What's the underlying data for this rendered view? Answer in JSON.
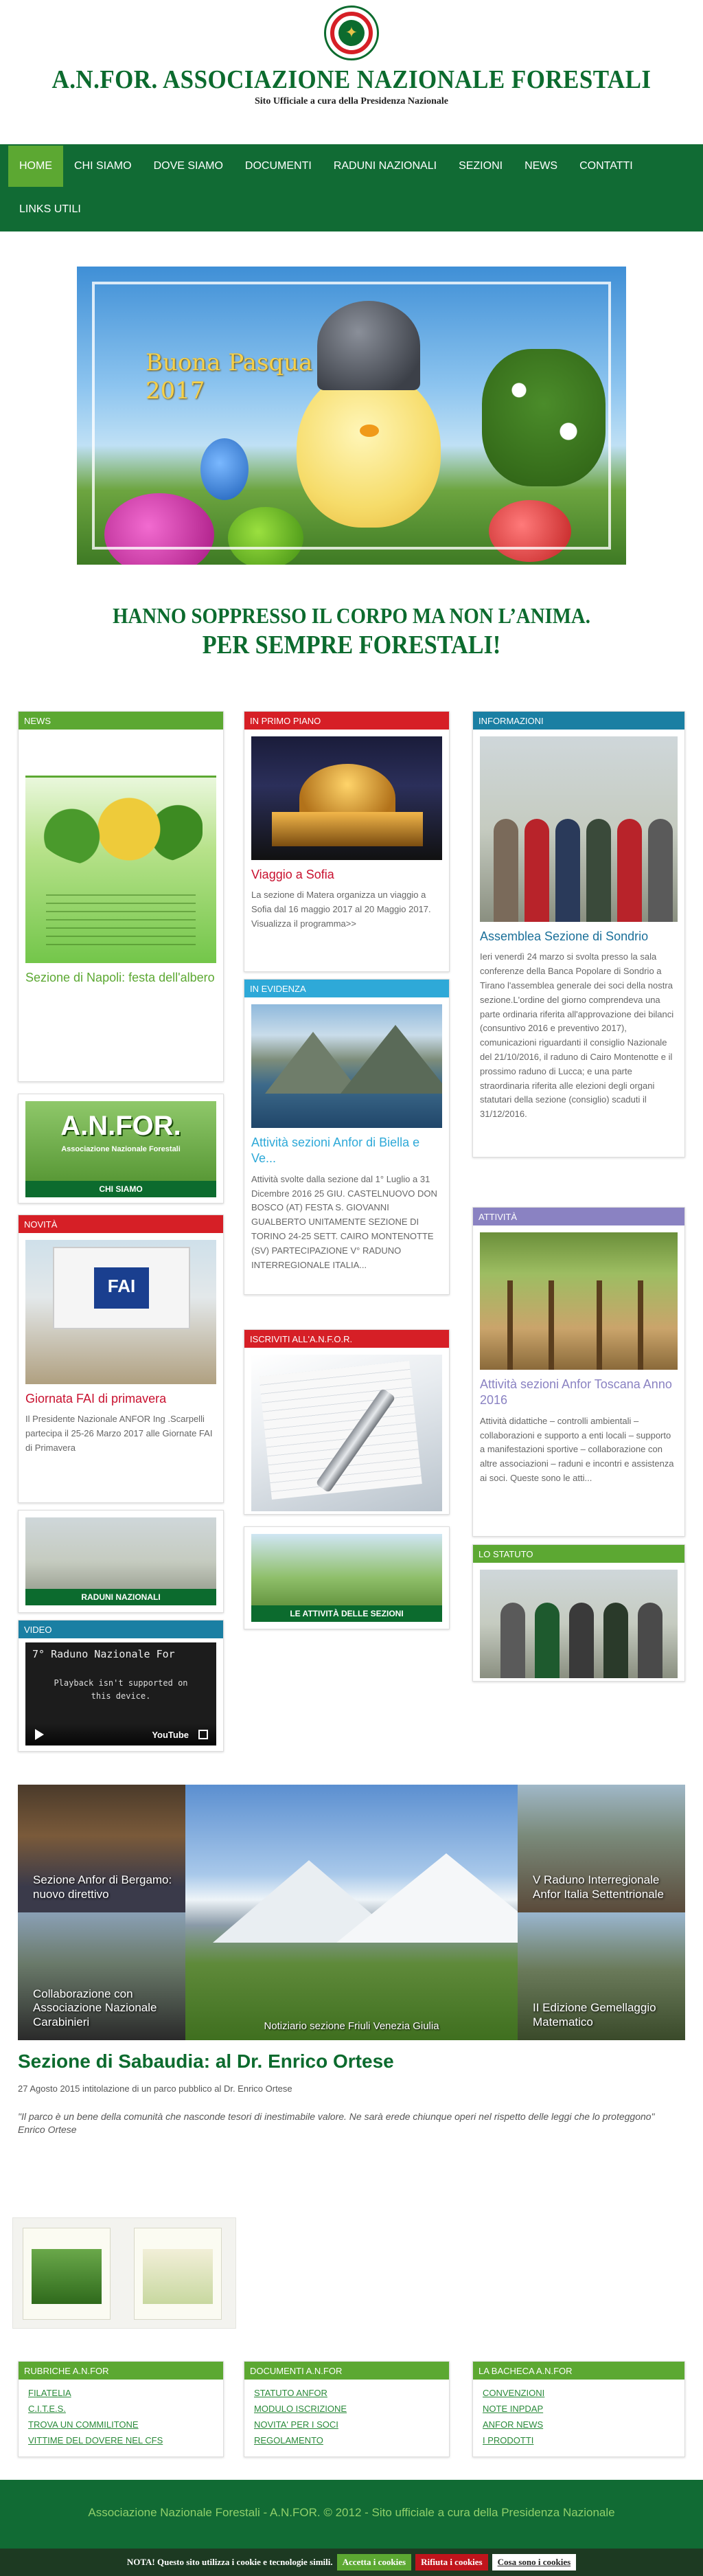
{
  "header": {
    "title": "A.N.FOR. ASSOCIAZIONE NAZIONALE FORESTALI",
    "tagline": "Sito Ufficiale a cura della Presidenza Nazionale"
  },
  "nav": {
    "items": [
      {
        "label": "HOME"
      },
      {
        "label": "CHI SIAMO"
      },
      {
        "label": "DOVE SIAMO"
      },
      {
        "label": "DOCUMENTI"
      },
      {
        "label": "RADUNI NAZIONALI"
      },
      {
        "label": "SEZIONI"
      },
      {
        "label": "NEWS"
      },
      {
        "label": "CONTATTI"
      },
      {
        "label": "LINKS UTILI"
      }
    ]
  },
  "hero": {
    "caption_line1": "Buona Pasqua",
    "caption_line2": "2017"
  },
  "slogan": {
    "line1": "HANNO SOPPRESSO IL CORPO MA NON L’ANIMA.",
    "line2": "PER SEMPRE FORESTALI!"
  },
  "col1": {
    "news": {
      "head": "NEWS",
      "title": "Sezione di Napoli: festa dell'albero"
    },
    "chi_siamo": {
      "logo_text": "A.N.FOR.",
      "logo_sub": "Associazione Nazionale Forestali",
      "caption": "CHI SIAMO"
    },
    "novita": {
      "head": "NOVITÀ",
      "sign": "FAI",
      "title": "Giornata FAI di primavera",
      "text": "Il Presidente Nazionale ANFOR Ing .Scarpelli partecipa il 25-26 Marzo 2017 alle  Giornate FAI di Primavera"
    },
    "raduni": {
      "caption": "RADUNI NAZIONALI"
    },
    "video": {
      "head": "VIDEO",
      "video_title": "7° Raduno Nazionale For",
      "msg_line1": "Playback isn't supported on",
      "msg_line2": "this device.",
      "yt": "YouTube"
    }
  },
  "col2": {
    "primo_piano": {
      "head": "IN PRIMO PIANO",
      "title": "Viaggio a Sofia",
      "text": "La sezione di Matera organizza un viaggio a Sofia dal 16 maggio 2017 al 20 Maggio 2017.  Visualizza il programma>>"
    },
    "evidenza": {
      "head": "IN EVIDENZA",
      "title": "Attività sezioni Anfor di Biella e Ve...",
      "text": "Attività svolte dalla sezione dal 1° Luglio a 31 Dicembre 2016 25 GIU. CASTELNUOVO DON BOSCO (AT) FESTA S. GIOVANNI GUALBERTO UNITAMENTE SEZIONE DI TORINO 24-25 SETT. CAIRO MONTENOTTE (SV) PARTECIPAZIONE V° RADUNO INTERREGIONALE ITALIA..."
    },
    "iscriviti": {
      "head": "ISCRIVITI ALL'A.N.F.O.R."
    },
    "attivita": {
      "caption": "LE ATTIVITÀ DELLE SEZIONI"
    }
  },
  "col3": {
    "informazioni": {
      "head": "INFORMAZIONI",
      "title": "Assemblea Sezione di Sondrio",
      "text": "Ieri venerdì 24 marzo si svolta presso la sala conferenze della Banca Popolare di Sondrio a Tirano l'assemblea generale dei soci della nostra sezione.L'ordine del giorno comprendeva una parte ordinaria riferita all'approvazione dei bilanci (consuntivo 2016 e preventivo 2017), comunicazioni riguardanti il consiglio Nazionale del 21/10/2016, il raduno di Cairo Montenotte e il prossimo raduno di Lucca; e una parte straordinaria riferita alle elezioni degli organi statutari della sezione (consiglio) scaduti il 31/12/2016."
    },
    "attivita": {
      "head": "ATTIVITÀ",
      "title": "Attività sezioni Anfor Toscana Anno 2016",
      "text": "Attività didattiche – controlli ambientali – collaborazioni e supporto a enti locali – supporto a manifestazioni sportive – collaborazione con altre associazioni – raduni e incontri e assistenza ai soci. Queste sono le atti..."
    },
    "statuto": {
      "head": "LO STATUTO"
    }
  },
  "gallery": {
    "center_caption": "Notiziario sezione Friuli Venezia Giulia",
    "thumbs": [
      {
        "caption": "Sezione Anfor di Bergamo: nuovo direttivo"
      },
      {
        "caption": "Collaborazione con Associazione Nazionale Carabinieri"
      },
      {
        "caption": "V Raduno Interregionale Anfor Italia Settentrionale"
      },
      {
        "caption": "II Edizione Gemellaggio Matematico"
      }
    ]
  },
  "article": {
    "title": "Sezione di Sabaudia: al Dr. Enrico Ortese",
    "meta": "27 Agosto 2015 intitolazione di un parco pubblico al Dr. Enrico Ortese",
    "quote": "\"Il parco è un bene della comunità che nasconde tesori di inestimabile valore. Ne sarà erede chiunque operi nel rispetto delle leggi che lo proteggono\"",
    "author": "Enrico Ortese"
  },
  "footer_widgets": [
    {
      "head": "RUBRICHE A.N.FOR",
      "links": [
        "FILATELIA",
        "C.I.T.E.S.",
        "TROVA UN COMMILITONE",
        "VITTIME DEL DOVERE NEL CFS"
      ]
    },
    {
      "head": "DOCUMENTI A.N.FOR",
      "links": [
        "STATUTO ANFOR",
        "MODULO ISCRIZIONE",
        "NOVITA' PER I SOCI",
        "REGOLAMENTO"
      ]
    },
    {
      "head": "LA BACHECA A.N.FOR",
      "links": [
        "CONVENZIONI",
        "NOTE INPDAP",
        "ANFOR NEWS",
        "I PRODOTTI"
      ]
    }
  ],
  "footer": {
    "copyright": "Associazione Nazionale Forestali - A.N.FOR. © 2012 - Sito ufficiale a cura della Presidenza Nazionale"
  },
  "cookie": {
    "message": "NOTA! Questo sito utilizza i cookie e tecnologie simili.",
    "accept": "Accetta i cookies",
    "reject": "Rifiuta i cookies",
    "more": "Cosa sono i cookies"
  },
  "colors": {
    "brand_green": "#0c6b2e",
    "nav_green": "#116b34",
    "accent_green": "#5ca832",
    "accent_red": "#d61f26"
  }
}
